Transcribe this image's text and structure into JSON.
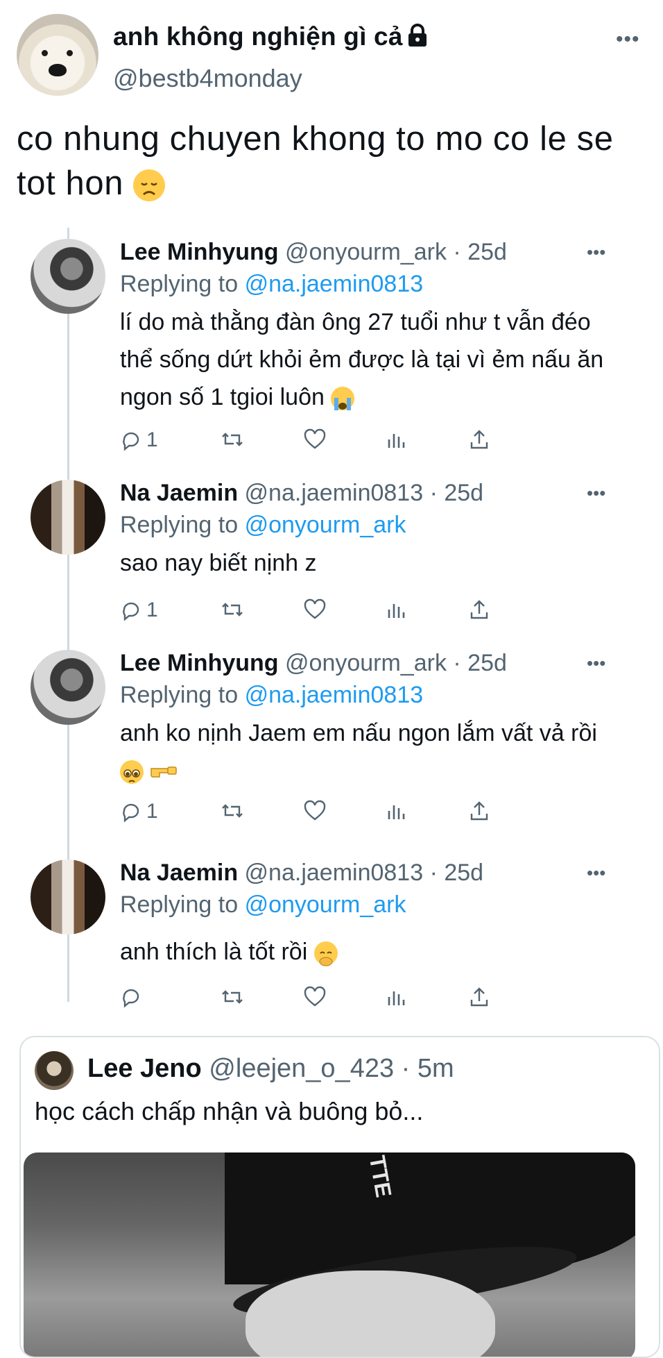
{
  "tweet": {
    "display_name": "anh không nghiện gì cả",
    "handle": "@bestb4monday",
    "text": "co nhung chuyen khong to mo co le se tot hon",
    "more_label": "•••"
  },
  "replies": [
    {
      "name": "Lee Minhyung",
      "meta": "@onyourm_ark · 25d",
      "replying_prefix": "Replying to",
      "mention": "@na.jaemin0813",
      "text": "lí do mà thằng đàn ông 27 tuổi như t vẫn đéo thể sống dứt khỏi ẻm được là tại vì ẻm nấu ăn ngon số 1 tgioi luôn",
      "reply_count": "1"
    },
    {
      "name": "Na Jaemin",
      "meta": "@na.jaemin0813 · 25d",
      "replying_prefix": "Replying to",
      "mention": "@onyourm_ark",
      "text": "sao nay biết nịnh z",
      "reply_count": "1"
    },
    {
      "name": "Lee Minhyung",
      "meta": "@onyourm_ark · 25d",
      "replying_prefix": "Replying to",
      "mention": "@na.jaemin0813",
      "text": "anh ko nịnh Jaem em nấu ngon lắm vất vả rồi",
      "reply_count": "1"
    },
    {
      "name": "Na Jaemin",
      "meta": "@na.jaemin0813 · 25d",
      "replying_prefix": "Replying to",
      "mention": "@onyourm_ark",
      "text": "anh thích là tốt rồi",
      "reply_count": ""
    }
  ],
  "quote": {
    "name": "Lee Jeno",
    "meta": "@leejen_o_423 · 5m",
    "text": "học cách chấp nhận và buông bỏ..."
  },
  "icons": {
    "lock": "lock-icon",
    "reply": "reply-icon",
    "retweet": "retweet-icon",
    "like": "like-icon",
    "views": "views-icon",
    "share": "share-icon"
  },
  "colors": {
    "accent": "#1d9bf0",
    "secondary_text": "#536471",
    "primary_text": "#0f1419"
  }
}
